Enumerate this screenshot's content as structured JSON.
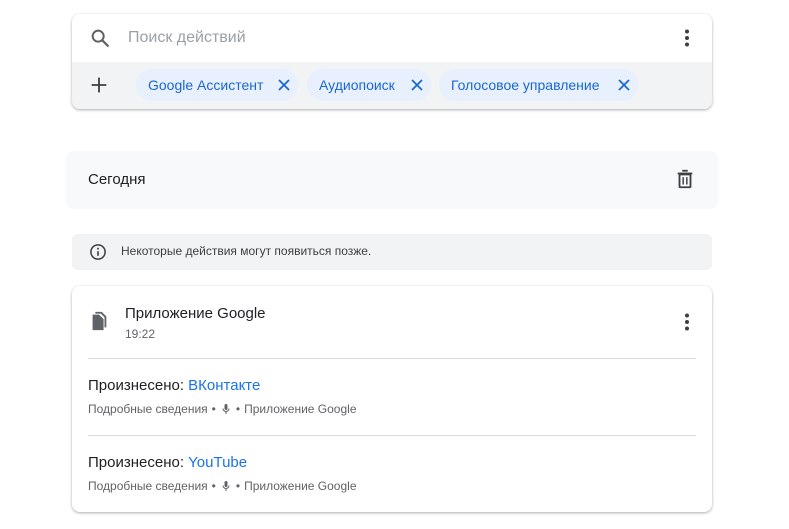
{
  "search": {
    "placeholder": "Поиск действий",
    "value": ""
  },
  "filters": {
    "chips": [
      {
        "label": "Google Ассистент"
      },
      {
        "label": "Аудиопоиск"
      },
      {
        "label": "Голосовое управление"
      }
    ]
  },
  "section": {
    "title": "Сегодня"
  },
  "notice": {
    "text": "Некоторые действия могут появиться позже."
  },
  "activity": {
    "app_name": "Приложение Google",
    "time": "19:22",
    "entries": [
      {
        "prefix": "Произнесено: ",
        "query": "ВКонтакте",
        "details": "Подробные сведения",
        "bullet": "•",
        "source_prefix": "•",
        "source": "Приложение Google"
      },
      {
        "prefix": "Произнесено: ",
        "query": "YouTube",
        "details": "Подробные сведения",
        "bullet": "•",
        "source_prefix": "•",
        "source": "Приложение Google"
      }
    ]
  },
  "colors": {
    "accent": "#1a73e8",
    "chip_bg": "#e8f0fe",
    "chip_text": "#1967d2",
    "icon_gray": "#5f6368"
  },
  "icons": {
    "search": "search-icon",
    "more": "more-vert-icon",
    "add": "add-icon",
    "close": "close-icon",
    "trash": "trash-icon",
    "info": "info-icon",
    "app": "google-app-icon",
    "mic": "mic-icon"
  }
}
